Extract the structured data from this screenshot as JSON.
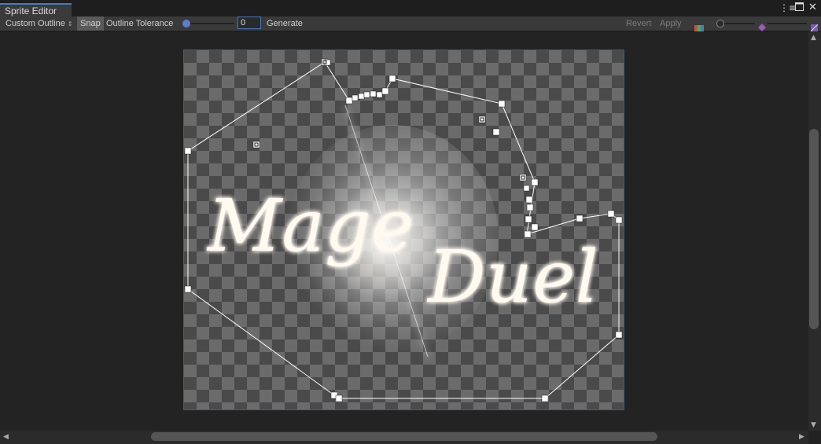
{
  "window": {
    "tab_title": "Sprite Editor",
    "menu_icon": "menu-icon",
    "maximize_icon": "maximize-icon",
    "close_icon": "close-icon"
  },
  "toolbar": {
    "mode_select": "Custom Outline",
    "mode_icon": "updown-arrows-icon",
    "snap_label": "Snap",
    "tolerance_label": "Outline Tolerance",
    "tolerance_value": "0",
    "tolerance_fraction": 0,
    "generate_label": "Generate",
    "revert_label": "Revert",
    "apply_label": "Apply",
    "color_channel_icon": "color-channels-icon",
    "zoom_slider_icon": "zoom-slider",
    "mip_icon": "mip-level-icon",
    "checker_icon": "alpha-checker-icon"
  },
  "sprite": {
    "artwork_text_line1": "Mage",
    "artwork_text_line2": "Duel",
    "artwork_icon": "glow-logo-artwork"
  },
  "colors": {
    "accent": "#4a78c0",
    "toolbar_bg": "#3a3a3a",
    "editor_bg": "#232323",
    "checker_light": "#6b6b6b",
    "checker_dark": "#4a4a4a"
  }
}
